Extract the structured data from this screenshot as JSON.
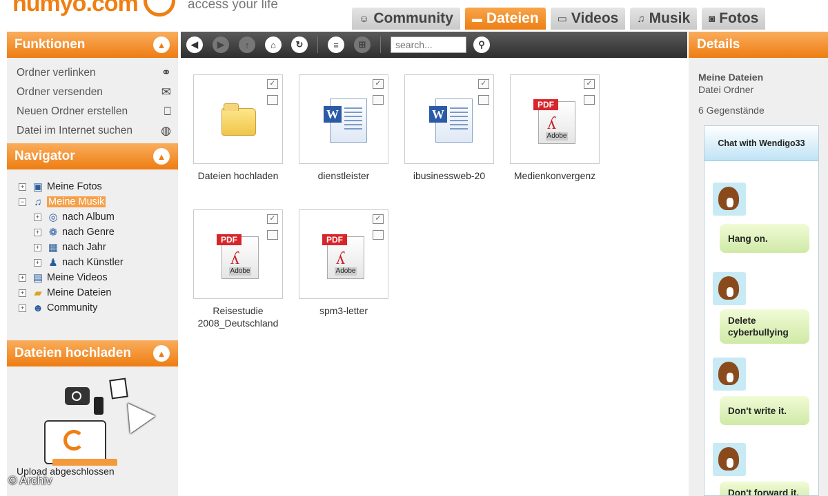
{
  "header": {
    "logo_text": "humyo.com",
    "tagline": "access your life",
    "tabs": [
      {
        "label": "Community",
        "icon": "community-icon",
        "active": false
      },
      {
        "label": "Dateien",
        "icon": "folder-icon",
        "active": true
      },
      {
        "label": "Videos",
        "icon": "film-icon",
        "active": false
      },
      {
        "label": "Musik",
        "icon": "music-note-icon",
        "active": false
      },
      {
        "label": "Fotos",
        "icon": "camera-icon",
        "active": false
      }
    ]
  },
  "colors": {
    "accent": "#ee7d12",
    "sidebar_bg": "#efefef",
    "toolbar_bg": "#3a3a3a"
  },
  "funktionen": {
    "title": "Funktionen",
    "items": [
      {
        "label": "Ordner verlinken",
        "icon": "link-icon"
      },
      {
        "label": "Ordner versenden",
        "icon": "mail-send-icon"
      },
      {
        "label": "Neuen Ordner erstellen",
        "icon": "new-folder-icon"
      },
      {
        "label": "Datei im Internet suchen",
        "icon": "globe-icon"
      }
    ]
  },
  "navigator": {
    "title": "Navigator",
    "nodes": [
      {
        "label": "Meine Fotos",
        "level": 1,
        "expanded": false,
        "selected": false
      },
      {
        "label": "Meine Musik",
        "level": 1,
        "expanded": true,
        "selected": true
      },
      {
        "label": "nach Album",
        "level": 2,
        "expanded": false,
        "selected": false
      },
      {
        "label": "nach Genre",
        "level": 2,
        "expanded": false,
        "selected": false
      },
      {
        "label": "nach Jahr",
        "level": 2,
        "expanded": false,
        "selected": false
      },
      {
        "label": "nach Künstler",
        "level": 2,
        "expanded": false,
        "selected": false
      },
      {
        "label": "Meine Videos",
        "level": 1,
        "expanded": false,
        "selected": false
      },
      {
        "label": "Meine Dateien",
        "level": 1,
        "expanded": false,
        "selected": false
      },
      {
        "label": "Community",
        "level": 1,
        "expanded": false,
        "selected": false
      }
    ]
  },
  "upload": {
    "title": "Dateien hochladen",
    "status": "Upload abgeschlossen"
  },
  "copyright": "© Archiv",
  "toolbar": {
    "search_placeholder": "search..."
  },
  "files": [
    {
      "name": "Dateien hochladen",
      "type": "folder"
    },
    {
      "name": "dienstleister",
      "type": "word"
    },
    {
      "name": "ibusinessweb-20",
      "type": "word"
    },
    {
      "name": "Medienkonvergenz",
      "type": "pdf"
    },
    {
      "name": "Reisestudie 2008_Deutschland",
      "type": "pdf"
    },
    {
      "name": "spm3-letter",
      "type": "pdf"
    }
  ],
  "details": {
    "title": "Details",
    "name": "Meine Dateien",
    "type": "Datei Ordner",
    "count": "6 Gegenstände"
  },
  "chat": {
    "title": "Chat with Wendigo33",
    "messages": [
      "Hang on.",
      "Delete cyberbullying",
      "Don't write it.",
      "Don't forward it."
    ]
  },
  "icons": {
    "pdf_tag": "PDF",
    "adobe_label": "Adobe",
    "word_letter": "W"
  }
}
